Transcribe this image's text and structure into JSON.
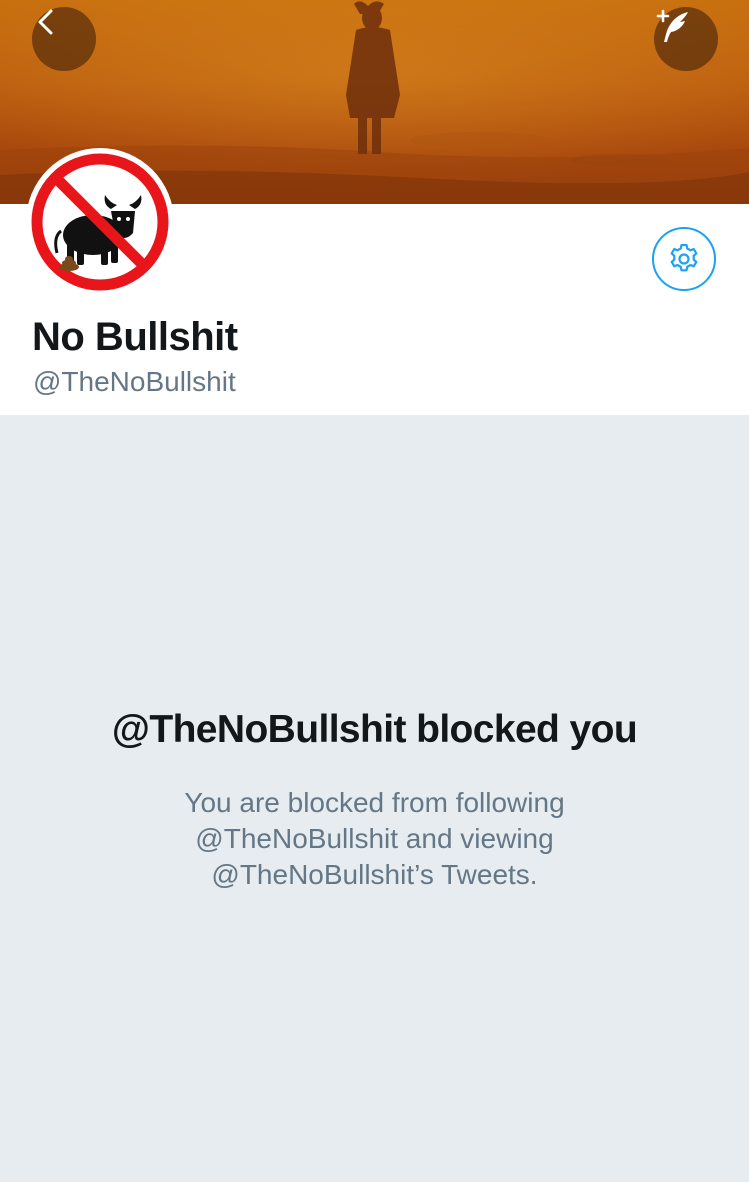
{
  "header": {
    "back_icon": "chevron-left-icon",
    "compose_icon": "compose-tweet-icon"
  },
  "profile": {
    "display_name": "No Bullshit",
    "handle": "@TheNoBullshit",
    "avatar_icon": "no-bull-sign-icon",
    "settings_icon": "gear-icon"
  },
  "blocked": {
    "title": "@TheNoBullshit blocked you",
    "message": "You are blocked from following @TheNoBullshit and viewing @TheNoBullshit’s Tweets."
  },
  "colors": {
    "accent": "#1da1f2",
    "background": "#e6ecf0",
    "text_primary": "#14171a",
    "text_secondary": "#657786",
    "prohibition_red": "#e8151b"
  }
}
